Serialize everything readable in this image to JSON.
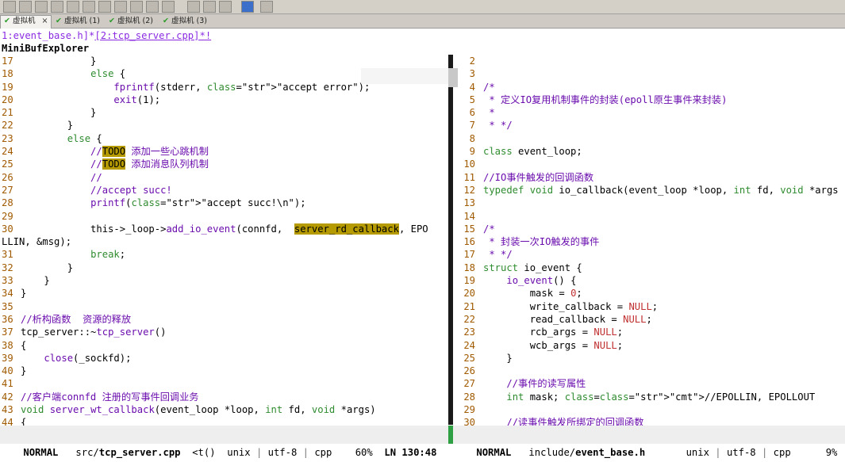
{
  "tabs": [
    {
      "label": "虚拟机",
      "active": true
    },
    {
      "label": "虚拟机 (1)",
      "active": false
    },
    {
      "label": "虚拟机 (2)",
      "active": false
    },
    {
      "label": "虚拟机 (3)",
      "active": false
    }
  ],
  "tab_close": "×",
  "buffer_line": {
    "prefix": "1:event_base.h]*",
    "current": "[2:tcp_server.cpp]*!"
  },
  "buf_explorer": "MiniBufExplorer",
  "left_lines": [
    {
      "n": "17",
      "t": "            }"
    },
    {
      "n": "18",
      "t": "            else {"
    },
    {
      "n": "19",
      "t": "                fprintf(stderr, \"accept error\");"
    },
    {
      "n": "20",
      "t": "                exit(1);"
    },
    {
      "n": "21",
      "t": "            }"
    },
    {
      "n": "22",
      "t": "        }"
    },
    {
      "n": "23",
      "t": "        else {"
    },
    {
      "n": "24",
      "t": "            //TODO 添加一些心跳机制"
    },
    {
      "n": "25",
      "t": "            //TODO 添加消息队列机制"
    },
    {
      "n": "26",
      "t": "            //"
    },
    {
      "n": "27",
      "t": "            //accept succ!"
    },
    {
      "n": "28",
      "t": "            printf(\"accept succ!\\n\");"
    },
    {
      "n": "29",
      "t": ""
    },
    {
      "n": "30",
      "t": "            this->_loop->add_io_event(connfd,  server_rd_callback, EPO"
    },
    {
      "n": "",
      "t": "LLIN, &msg);"
    },
    {
      "n": "31",
      "t": "            break;"
    },
    {
      "n": "32",
      "t": "        }"
    },
    {
      "n": "33",
      "t": "    }"
    },
    {
      "n": "34",
      "t": "}"
    },
    {
      "n": "35",
      "t": ""
    },
    {
      "n": "36",
      "t": "//析构函数  资源的释放"
    },
    {
      "n": "37",
      "t": "tcp_server::~tcp_server()"
    },
    {
      "n": "38",
      "t": "{"
    },
    {
      "n": "39",
      "t": "    close(_sockfd);"
    },
    {
      "n": "40",
      "t": "}"
    },
    {
      "n": "41",
      "t": ""
    },
    {
      "n": "42",
      "t": "//客户端connfd 注册的写事件回调业务"
    },
    {
      "n": "43",
      "t": "void server_wt_callback(event_loop *loop, int fd, void *args)"
    },
    {
      "n": "44",
      "t": "{"
    }
  ],
  "right_lines": [
    {
      "n": "2",
      "t": ""
    },
    {
      "n": "3",
      "t": ""
    },
    {
      "n": "4",
      "t": "/*"
    },
    {
      "n": "5",
      "t": " * 定义IO复用机制事件的封装(epoll原生事件来封装)"
    },
    {
      "n": "6",
      "t": " *"
    },
    {
      "n": "7",
      "t": " * */"
    },
    {
      "n": "8",
      "t": ""
    },
    {
      "n": "9",
      "t": "class event_loop;"
    },
    {
      "n": "10",
      "t": ""
    },
    {
      "n": "11",
      "t": "//IO事件触发的回调函数"
    },
    {
      "n": "12",
      "t": "typedef void io_callback(event_loop *loop, int fd, void *args"
    },
    {
      "n": "13",
      "t": ""
    },
    {
      "n": "14",
      "t": ""
    },
    {
      "n": "15",
      "t": "/*"
    },
    {
      "n": "16",
      "t": " * 封装一次IO触发的事件"
    },
    {
      "n": "17",
      "t": " * */"
    },
    {
      "n": "18",
      "t": "struct io_event {"
    },
    {
      "n": "19",
      "t": "    io_event() {"
    },
    {
      "n": "20",
      "t": "        mask = 0;"
    },
    {
      "n": "21",
      "t": "        write_callback = NULL;"
    },
    {
      "n": "22",
      "t": "        read_callback = NULL;"
    },
    {
      "n": "23",
      "t": "        rcb_args = NULL;"
    },
    {
      "n": "24",
      "t": "        wcb_args = NULL;"
    },
    {
      "n": "25",
      "t": "    }"
    },
    {
      "n": "26",
      "t": ""
    },
    {
      "n": "27",
      "t": "    //事件的读写属性"
    },
    {
      "n": "28",
      "t": "    int mask; //EPOLLIN, EPOLLOUT"
    },
    {
      "n": "29",
      "t": ""
    },
    {
      "n": "30",
      "t": "    //读事件触发所绑定的回调函数"
    }
  ],
  "status_left": {
    "mode": "NORMAL",
    "path": "src/",
    "file": "tcp_server.cpp",
    "tag": "<t()",
    "fmt": "unix",
    "enc": "utf-8",
    "ft": "cpp",
    "pct": "60%",
    "pos": "LN 130:48"
  },
  "status_right": {
    "mode": "NORMAL",
    "path": "include/",
    "file": "event_base.h",
    "fmt": "unix",
    "enc": "utf-8",
    "ft": "cpp",
    "pct": "9%"
  }
}
